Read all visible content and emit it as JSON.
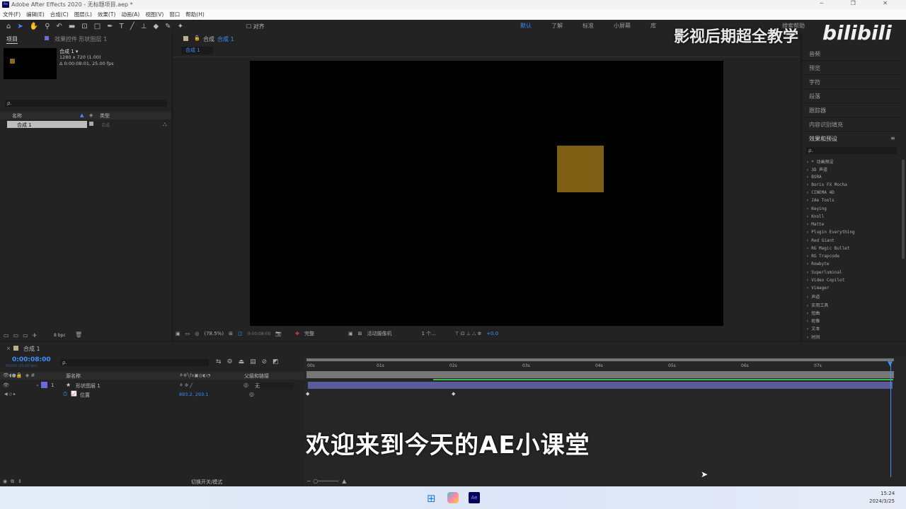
{
  "window": {
    "title": "Adobe After Effects 2020 - 无标题项目.aep *",
    "controls": "─ ❐ ✕"
  },
  "menu": [
    "文件(F)",
    "编辑(E)",
    "合成(C)",
    "图层(L)",
    "效果(T)",
    "动画(A)",
    "视图(V)",
    "窗口",
    "帮助(H)"
  ],
  "toolbar": {
    "snap_label": "对齐"
  },
  "workspaces": [
    "默认",
    "了解",
    "标准",
    "小屏幕",
    "库"
  ],
  "workspace_search": "搜索帮助",
  "project": {
    "tab": "项目",
    "effects_tab": "效果控件 形状图层 1",
    "comp_name": "合成 1 ▾",
    "comp_size": "1280 x 720 (1.00)",
    "comp_duration": "Δ 0:00:08:01, 25.00 fps",
    "search_placeholder": "ρ.",
    "col_name": "名称",
    "col_type": "类型",
    "item_name": "合成 1",
    "item_type": "合成",
    "bpc": "8 bpc"
  },
  "viewer": {
    "tab_prefix": "合成",
    "tab_name": "合成 1",
    "breadcrumb": "合成 1",
    "zoom": "(78.5%)",
    "timecode": "0:00:08:00",
    "quality": "完整",
    "camera": "活动摄像机",
    "views": "1 个...",
    "exposure": "+0.0"
  },
  "right_panel": {
    "items": [
      "音频",
      "预览",
      "字符",
      "段落",
      "跟踪器",
      "内容识别填充"
    ],
    "effects_title": "效果和预设",
    "search": "ρ.",
    "effects": [
      "* 动画预设",
      "3D 声道",
      "BSRA",
      "Boris FX Mocha",
      "CINEMA 4D",
      "JAe Tools",
      "Keying",
      "Knoll",
      "Matte",
      "Plugin Everything",
      "Red Giant",
      "RG Magic Bullet",
      "RG Trapcode",
      "Rowbyte",
      "Superluminal",
      "Video Copilot",
      "Vimager",
      "声道",
      "实用工具",
      "扭曲",
      "抠像",
      "文本",
      "时间"
    ]
  },
  "timeline": {
    "tab": "合成 1",
    "timecode": "0:00:08:00",
    "frame_info": "00200 (25.00 fps)",
    "col_source": "源名称",
    "col_parent": "父级和链接",
    "layer_index": "1",
    "layer_name": "形状图层 1",
    "parent_value": "无",
    "property": "位置",
    "property_value": "893.2, 293.1",
    "ruler": [
      "00s",
      "01s",
      "02s",
      "03s",
      "04s",
      "05s",
      "06s",
      "07s"
    ],
    "toggle_label": "切换开关/模式"
  },
  "overlay": {
    "subtitle": "欢迎来到今天的AE小课堂",
    "watermark": "影视后期超全教学",
    "logo": "bilibili"
  },
  "taskbar": {
    "time": "15:24",
    "date": "2024/3/25"
  },
  "colors": {
    "accent": "#3d8eff",
    "layer_bar": "#5a5d9a",
    "solid": "#7f5f14",
    "work_area": "#3bbd4a"
  }
}
